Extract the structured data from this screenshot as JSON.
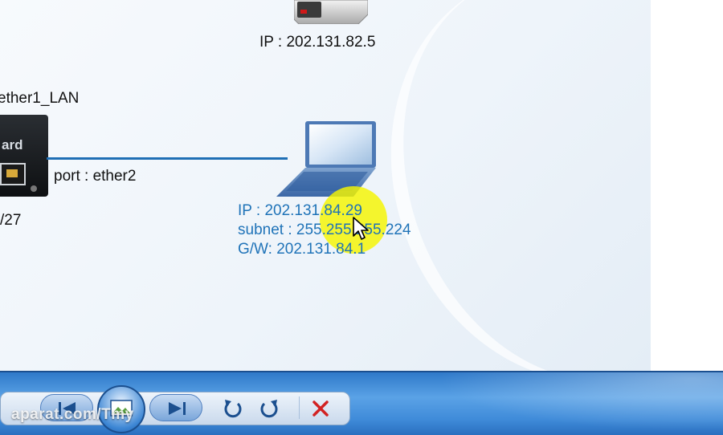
{
  "diagram": {
    "server_ip": "IP : 202.131.82.5",
    "router_interface": "ether1_LAN",
    "router_port": "port : ether2",
    "router_cidr": "/27",
    "router_brand": "ard",
    "laptop_ip": "IP : 202.131.84.29",
    "laptop_subnet": "subnet : 255.255.255.224",
    "laptop_gateway": "G/W: 202.131.84.1"
  },
  "player": {
    "controls": [
      "previous-icon",
      "play-icon",
      "next-icon",
      "rotate-left-icon",
      "rotate-right-icon",
      "delete-icon"
    ]
  },
  "watermark": "aparat.com/Tmy",
  "colors": {
    "link_line": "#1f6fb5",
    "label_blue": "#1f73b8",
    "taskbar": "#3f8bd9",
    "delete_red": "#d22222",
    "highlight": "#f5f500"
  }
}
